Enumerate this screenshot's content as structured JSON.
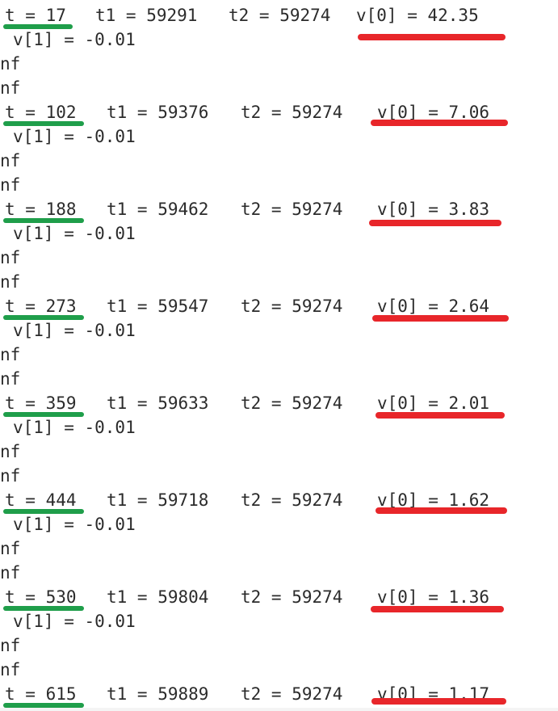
{
  "blocks": [
    {
      "t": "t = 17",
      "t1": "t1 = 59291",
      "t2": "t2 = 59274",
      "v0": "v[0] = 42.35",
      "v1": "v[1] = -0.01",
      "n1": "nf",
      "n2": "nf"
    },
    {
      "t": "t = 102",
      "t1": "t1 = 59376",
      "t2": "t2 = 59274",
      "v0": "v[0] = 7.06",
      "v1": "v[1] = -0.01",
      "n1": "nf",
      "n2": "nf"
    },
    {
      "t": "t = 188",
      "t1": "t1 = 59462",
      "t2": "t2 = 59274",
      "v0": "v[0] = 3.83",
      "v1": "v[1] = -0.01",
      "n1": "nf",
      "n2": "nf"
    },
    {
      "t": "t = 273",
      "t1": "t1 = 59547",
      "t2": "t2 = 59274",
      "v0": "v[0] = 2.64",
      "v1": "v[1] = -0.01",
      "n1": "nf",
      "n2": "nf"
    },
    {
      "t": "t = 359",
      "t1": "t1 = 59633",
      "t2": "t2 = 59274",
      "v0": "v[0] = 2.01",
      "v1": "v[1] = -0.01",
      "n1": "nf",
      "n2": "nf"
    },
    {
      "t": "t = 444",
      "t1": "t1 = 59718",
      "t2": "t2 = 59274",
      "v0": "v[0] = 1.62",
      "v1": "v[1] = -0.01",
      "n1": "nf",
      "n2": "nf"
    },
    {
      "t": "t = 530",
      "t1": "t1 = 59804",
      "t2": "t2 = 59274",
      "v0": "v[0] = 1.36",
      "v1": "v[1] = -0.01",
      "n1": "nf",
      "n2": "nf"
    },
    {
      "t": "t = 615",
      "t1": "t1 = 59889",
      "t2": "t2 = 59274",
      "v0": "v[0] = 1.17"
    }
  ],
  "colors": {
    "green_underline": "#1f9e4a",
    "red_underline": "#e8262a",
    "text": "#2b2b2b",
    "background": "#ffffff"
  }
}
